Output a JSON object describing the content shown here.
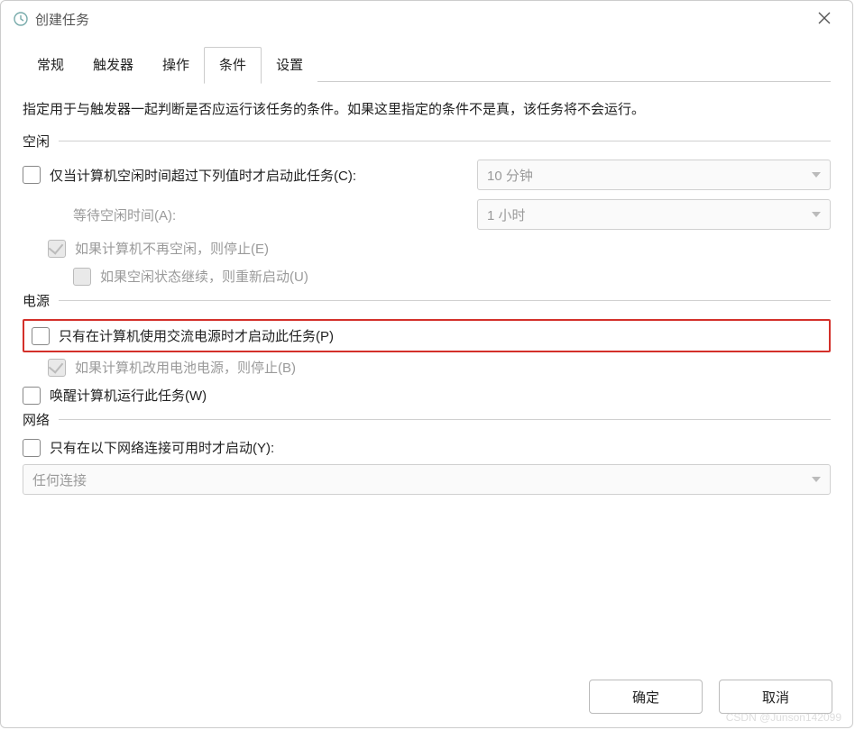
{
  "window": {
    "title": "创建任务"
  },
  "tabs": [
    "常规",
    "触发器",
    "操作",
    "条件",
    "设置"
  ],
  "active_tab_index": 3,
  "description": "指定用于与触发器一起判断是否应运行该任务的条件。如果这里指定的条件不是真，该任务将不会运行。",
  "sections": {
    "idle": {
      "label": "空闲",
      "start_if_idle": "仅当计算机空闲时间超过下列值时才启动此任务(C):",
      "idle_duration": "10 分钟",
      "wait_label": "等待空闲时间(A):",
      "wait_value": "1 小时",
      "stop_if_not_idle": "如果计算机不再空闲，则停止(E)",
      "restart_if_idle": "如果空闲状态继续，则重新启动(U)"
    },
    "power": {
      "label": "电源",
      "ac_only": "只有在计算机使用交流电源时才启动此任务(P)",
      "stop_on_battery": "如果计算机改用电池电源，则停止(B)",
      "wake_to_run": "唤醒计算机运行此任务(W)"
    },
    "network": {
      "label": "网络",
      "only_if_network": "只有在以下网络连接可用时才启动(Y):",
      "connection": "任何连接"
    }
  },
  "buttons": {
    "ok": "确定",
    "cancel": "取消"
  },
  "watermark": "CSDN @Junson142099"
}
